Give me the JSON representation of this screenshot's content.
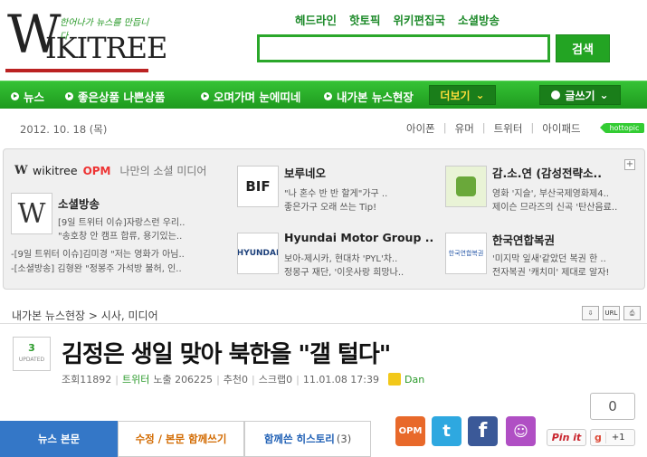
{
  "logo": {
    "w": "W",
    "rest": "IKITREE",
    "tagline": "한어나가 뉴스를 만듭니다"
  },
  "toplinks": [
    "헤드라인",
    "핫토픽",
    "위키편집국",
    "소셜방송"
  ],
  "search": {
    "value": "",
    "button": "검색"
  },
  "nav": {
    "items": [
      "뉴스",
      "좋은상품 나쁜상품",
      "오며가며 눈에띠네",
      "내가본 뉴스현장"
    ],
    "more": "더보기",
    "write": "글쓰기"
  },
  "datebar": {
    "date": "2012. 10. 18 (목)",
    "links": [
      "아이폰",
      "유머",
      "트위터",
      "아이패드"
    ],
    "hottopic": "hottopic"
  },
  "panel": {
    "brand": "wikitree",
    "opm": "OPM",
    "desc": "나만의 소셜 미디어",
    "plus": "+",
    "cards": [
      {
        "title": "소셜방송",
        "lines": [
          "[9일 트위터 이슈]자랑스런 우리..",
          "\"송호창 안 캠프 합류, 용기있는..",
          "-[9일 트위터 이슈]김미경 \"저는 영화가 아님..",
          "-[소셜방송] 김형완 \"정봉주 가석방 불허, 인.."
        ],
        "thumb": "W"
      },
      {
        "title": "보루네오",
        "lines": [
          "\"나 혼수 반 반 할게\"가구 ..",
          "좋은가구 오래 쓰는 Tip!"
        ],
        "thumb": "BIF"
      },
      {
        "title": "감.소.연 (감성전략소..",
        "lines": [
          "영화 '지슬', 부산국제영화제4..",
          "제이슨 므라즈의 신곡 '탄산음료.."
        ],
        "thumb": ""
      },
      {
        "title": "Hyundai Motor Group ..",
        "lines": [
          "보아-제시카, 현대차 'PYL'차..",
          "정몽구 재단, '이웃사랑 희망나.."
        ],
        "thumb": "HYUNDAI"
      },
      {
        "title": "한국연합복권",
        "lines": [
          "'미지막 잎새'같았던 복권 한 ..",
          "전자복권 '캐치미' 제대로 알자!"
        ],
        "thumb": "한국연합복권"
      }
    ]
  },
  "breadcrumb": "내가본 뉴스현장 > 시사, 미디어",
  "bc_icons": [
    "⇩",
    "URL",
    "⎙"
  ],
  "article": {
    "updated_num": "3",
    "updated_label": "UPDATED",
    "headline": "김정은 생일 맞아 북한을 \"갤 털다\"",
    "views": "조회11892",
    "twitter": "트위터",
    "exposure": "노출 206225",
    "recommend": "추천0",
    "scrap": "스크랩0",
    "datetime": "11.01.08 17:39",
    "author": "Dan"
  },
  "count": "0",
  "tabs": {
    "main": "뉴스 본문",
    "edit": "수정 / 본문 함께쓰기",
    "history": "함께쓴 히스토리",
    "history_count": "(3)"
  },
  "share": {
    "opm": "OPM",
    "pinit": "Pin it",
    "gplus_g": "g",
    "gplus_p": "+1"
  }
}
